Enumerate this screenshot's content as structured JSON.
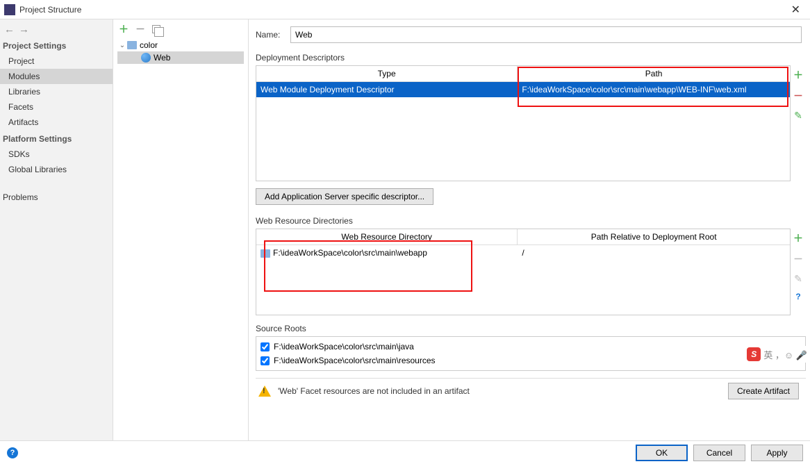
{
  "window": {
    "title": "Project Structure"
  },
  "sidebar": {
    "section1": "Project Settings",
    "items1": [
      "Project",
      "Modules",
      "Libraries",
      "Facets",
      "Artifacts"
    ],
    "section2": "Platform Settings",
    "items2": [
      "SDKs",
      "Global Libraries"
    ],
    "section3": "Problems"
  },
  "tree": {
    "root": "color",
    "child": "Web"
  },
  "name_label": "Name:",
  "name_value": "Web",
  "dd": {
    "title": "Deployment Descriptors",
    "col_type": "Type",
    "col_path": "Path",
    "row_type": "Web Module Deployment Descriptor",
    "row_path": "F:\\ideaWorkSpace\\color\\src\\main\\webapp\\WEB-INF\\web.xml",
    "button": "Add Application Server specific descriptor..."
  },
  "wr": {
    "title": "Web Resource Directories",
    "col_dir": "Web Resource Directory",
    "col_rel": "Path Relative to Deployment Root",
    "row_dir": "F:\\ideaWorkSpace\\color\\src\\main\\webapp",
    "row_rel": "/"
  },
  "sr": {
    "title": "Source Roots",
    "items": [
      "F:\\ideaWorkSpace\\color\\src\\main\\java",
      "F:\\ideaWorkSpace\\color\\src\\main\\resources"
    ]
  },
  "warn": {
    "msg": "'Web' Facet resources are not included in an artifact",
    "btn": "Create Artifact"
  },
  "footer": {
    "ok": "OK",
    "cancel": "Cancel",
    "apply": "Apply"
  },
  "ime": {
    "text": "英 ，☺ 🎤"
  }
}
